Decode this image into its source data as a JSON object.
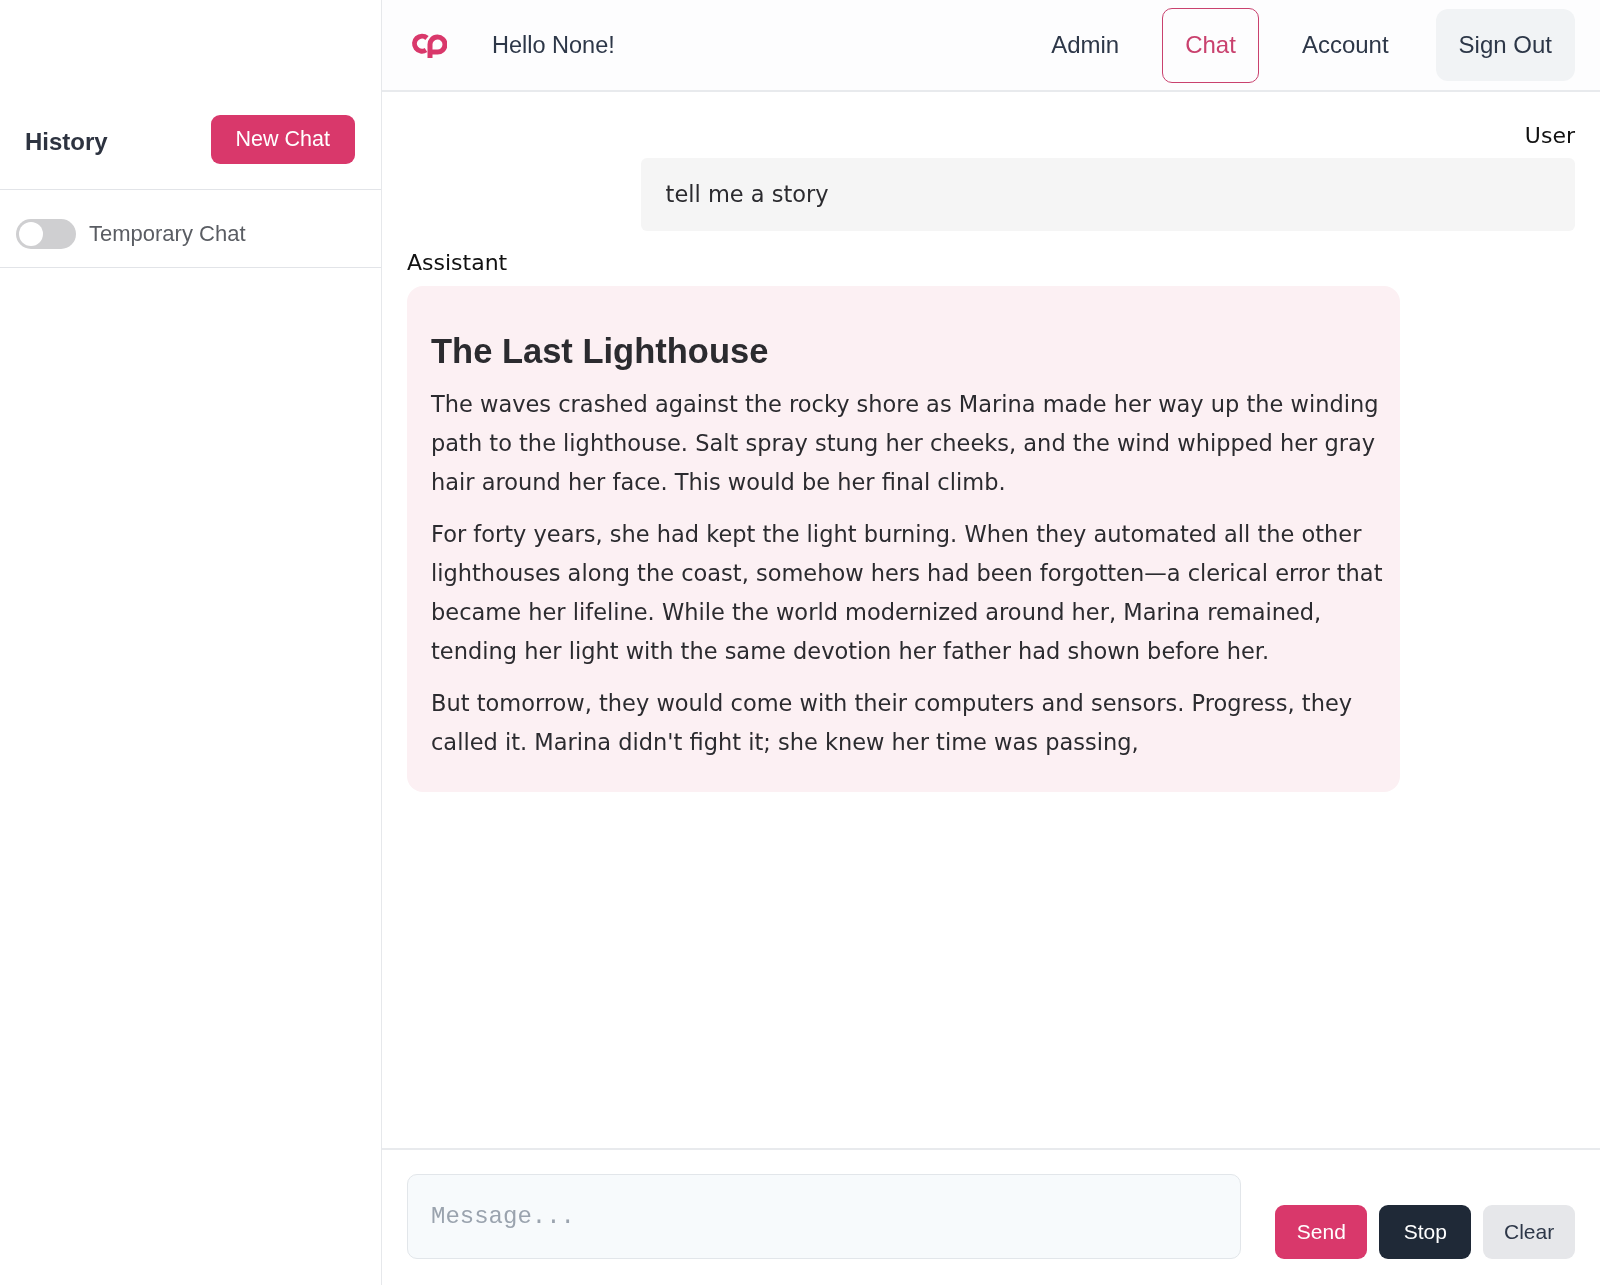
{
  "header": {
    "greeting": "Hello None!",
    "nav": [
      {
        "label": "Admin",
        "selected": false
      },
      {
        "label": "Chat",
        "selected": true
      },
      {
        "label": "Account",
        "selected": false
      }
    ],
    "sign_out": "Sign Out"
  },
  "sidebar": {
    "title": "History",
    "new_chat": "New Chat",
    "temporary_chat": {
      "label": "Temporary Chat",
      "on": false
    }
  },
  "messages": [
    {
      "kind": "user",
      "author": "User",
      "paragraphs": [
        "tell me a story"
      ]
    },
    {
      "kind": "assistant",
      "author": "Assistant",
      "title": "The Last Lighthouse",
      "paragraphs": [
        "The waves crashed against the rocky shore as Marina made her way up the winding path to the lighthouse. Salt spray stung her cheeks, and the wind whipped her gray hair around her face. This would be her final climb.",
        "For forty years, she had kept the light burning. When they automated all the other lighthouses along the coast, somehow hers had been forgotten—a clerical error that became her lifeline. While the world modernized around her, Marina remained, tending her light with the same devotion her father had shown before her.",
        "But tomorrow, they would come with their computers and sensors. Progress, they called it. Marina didn't fight it; she knew her time was passing,"
      ]
    }
  ],
  "composer": {
    "placeholder": "Message...",
    "buttons": [
      {
        "kind": "send",
        "label": "Send"
      },
      {
        "kind": "stop",
        "label": "Stop"
      },
      {
        "kind": "clear",
        "label": "Clear"
      }
    ]
  }
}
